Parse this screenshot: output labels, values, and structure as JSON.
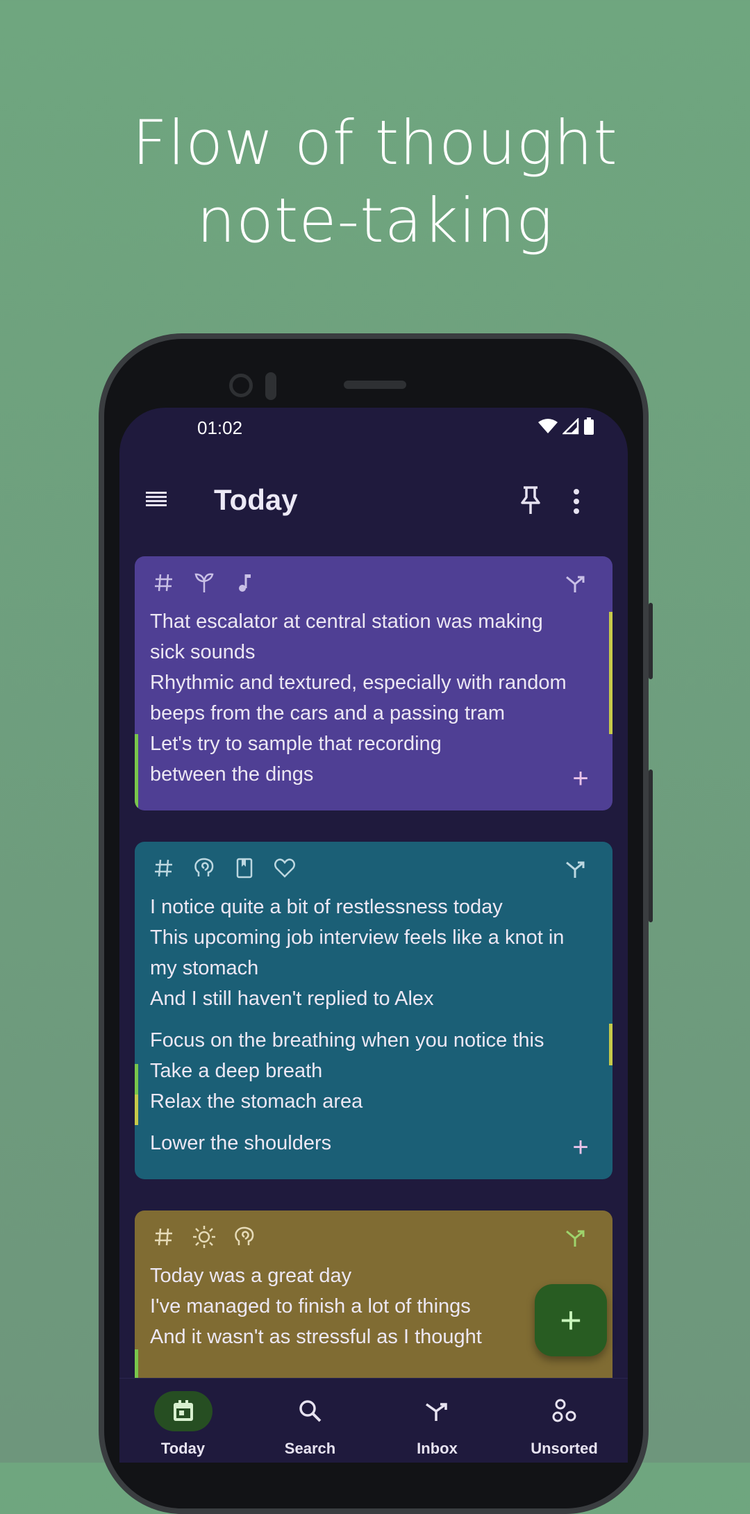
{
  "headline": {
    "line1": "Flow of thought",
    "line2": "note-taking"
  },
  "status": {
    "time": "01:02"
  },
  "appbar": {
    "title": "Today"
  },
  "cards": [
    {
      "color": "#4f3f94",
      "icons": [
        "hash-icon",
        "sprout-icon",
        "music-note-icon"
      ],
      "lines": [
        "That escalator at central station was making",
        "sick sounds",
        "Rhythmic and textured, especially with random",
        "beeps from the cars and a passing tram",
        "Let's try to sample that recording",
        "between the dings"
      ]
    },
    {
      "color": "#1b5f76",
      "icons": [
        "hash-icon",
        "brain-spiral-icon",
        "bookmark-icon",
        "heart-icon"
      ],
      "lines": [
        "I notice quite a bit of restlessness today",
        "This upcoming job interview feels like a knot in",
        "my stomach",
        "And I still haven't replied to Alex",
        "Focus on the breathing when you notice this",
        "Take a deep breath",
        "Relax the stomach area",
        "Lower the shoulders"
      ]
    },
    {
      "color": "#806c33",
      "icons": [
        "hash-icon",
        "sun-icon",
        "brain-spiral-icon"
      ],
      "lines": [
        "Today was a great day",
        "I've managed to finish a lot of things",
        "And it wasn't as stressful as I thought"
      ]
    }
  ],
  "fab": {
    "label": "+"
  },
  "nav": [
    {
      "label": "Today",
      "icon": "calendar-icon",
      "active": true
    },
    {
      "label": "Search",
      "icon": "search-icon",
      "active": false
    },
    {
      "label": "Inbox",
      "icon": "merge-icon",
      "active": false
    },
    {
      "label": "Unsorted",
      "icon": "bubbles-icon",
      "active": false
    }
  ]
}
